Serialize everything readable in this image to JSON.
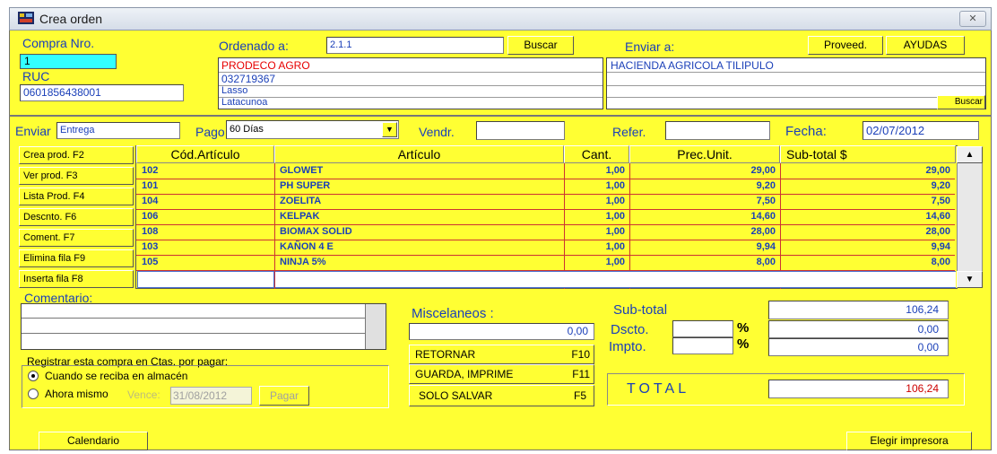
{
  "window": {
    "title": "Crea  orden",
    "close_label": "✕"
  },
  "header": {
    "compra_label": "Compra Nro.",
    "compra_value": "1",
    "ruc_label": "RUC",
    "ruc_value": "0601856438001",
    "ordenado_label": "Ordenado a:",
    "ordenado_value": "2.1.1",
    "buscar_label": "Buscar",
    "vendor_lines": [
      "PRODECO AGRO",
      "032719367",
      "Lasso",
      "Latacunoa"
    ],
    "enviar_a_label": "Enviar a:",
    "proveed_label": "Proveed.",
    "ayudas_label": "AYUDAS",
    "ship_lines": [
      "HACIENDA AGRICOLA TILIPULO",
      "",
      "",
      ""
    ],
    "ship_buscar_label": "Buscar"
  },
  "options": {
    "enviar_label": "Enviar",
    "enviar_value": "Entrega",
    "pago_label": "Pago",
    "pago_value": "60 Días",
    "vendr_label": "Vendr.",
    "vendr_value": "",
    "refer_label": "Refer.",
    "refer_value": "",
    "fecha_label": "Fecha:",
    "fecha_value": "02/07/2012"
  },
  "side_buttons": [
    "Crea prod. F2",
    "Ver prod.   F3",
    "Lista Prod. F4",
    "Descnto.   F6",
    "Coment.    F7",
    "Elimina fila  F9",
    "Inserta fila  F8"
  ],
  "table": {
    "headers": [
      "Cód.Artículo",
      "Artículo",
      "Cant.",
      "Prec.Unit.",
      "Sub-total  $"
    ],
    "rows": [
      [
        "102",
        "GLOWET",
        "1,00",
        "29,00",
        "29,00"
      ],
      [
        "101",
        "PH SUPER",
        "1,00",
        "9,20",
        "9,20"
      ],
      [
        "104",
        "ZOELITA",
        "1,00",
        "7,50",
        "7,50"
      ],
      [
        "106",
        "KELPAK",
        "1,00",
        "14,60",
        "14,60"
      ],
      [
        "108",
        "BIOMAX SOLID",
        "1,00",
        "28,00",
        "28,00"
      ],
      [
        "103",
        "KAÑON 4 E",
        "1,00",
        "9,94",
        "9,94"
      ],
      [
        "105",
        "NINJA 5%",
        "1,00",
        "8,00",
        "8,00"
      ]
    ]
  },
  "comments": {
    "label": "Comentario:"
  },
  "misc": {
    "label": "Miscelaneos :",
    "value": "0,00"
  },
  "actions": {
    "retornar_label": "RETORNAR",
    "retornar_key": "F10",
    "guarda_label": "GUARDA,  IMPRIME",
    "guarda_key": "F11",
    "salvar_label": "SOLO SALVAR",
    "salvar_key": "F5"
  },
  "totals": {
    "subtotal_label": "Sub-total",
    "subtotal_value": "106,24",
    "dscto_label": "Dscto.",
    "dscto_pct": "%",
    "dscto_value": "0,00",
    "impto_label": "Impto.",
    "impto_pct": "%",
    "impto_value": "0,00",
    "total_label": "TOTAL",
    "total_value": "106,24"
  },
  "register": {
    "label": "Registrar esta compra en Ctas. por pagar:",
    "option1": "Cuando se reciba en almacén",
    "option2": "Ahora mismo",
    "vence_label": "Vence:",
    "vence_value": "31/08/2012",
    "pagar_label": "Pagar"
  },
  "footer": {
    "calendario_label": "Calendario",
    "impresora_label": "Elegir impresora"
  },
  "colors": {
    "background": "#ffff33",
    "label_blue": "#1a3fb8",
    "vendor_red": "#e60000",
    "grid_red": "#cc3333",
    "total_red": "#cc0000",
    "compra_cyan": "#33ffff"
  }
}
